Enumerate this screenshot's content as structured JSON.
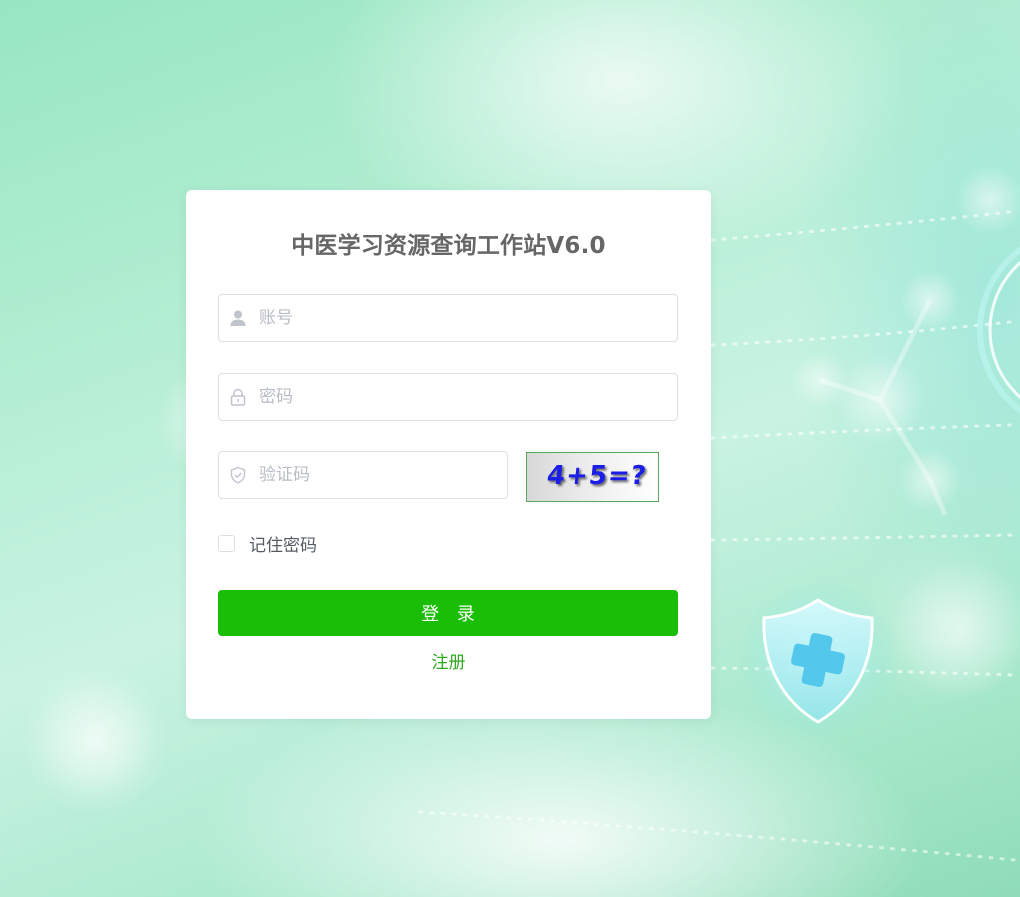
{
  "page": {
    "title": "中医学习资源查询工作站V6.0"
  },
  "login_form": {
    "account": {
      "placeholder": "账号",
      "value": "",
      "icon": "user-icon"
    },
    "password": {
      "placeholder": "密码",
      "value": "",
      "icon": "lock-icon"
    },
    "captcha": {
      "placeholder": "验证码",
      "value": "",
      "icon": "shield-check-icon",
      "image_text": "4+5=?"
    },
    "remember": {
      "label": "记住密码",
      "checked": false
    },
    "submit_label": "登 录",
    "register_label": "注册"
  },
  "colors": {
    "primary_button": "#1bbe07",
    "link": "#2daa1f",
    "title": "#666666",
    "background": "#b7efd6"
  }
}
